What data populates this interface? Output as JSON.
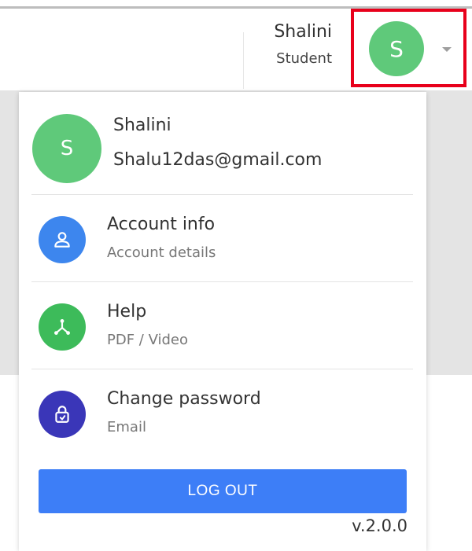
{
  "header": {
    "user_name": "Shalini",
    "user_role": "Student",
    "avatar_initial": "S"
  },
  "dropdown": {
    "avatar_initial": "S",
    "name": "Shalini",
    "email": "Shalu12das@gmail.com",
    "items": [
      {
        "title": "Account info",
        "subtitle": "Account details",
        "icon": "user-icon",
        "color": "#3d86ee"
      },
      {
        "title": "Help",
        "subtitle": "PDF / Video",
        "icon": "share-nodes-icon",
        "color": "#3dbb5a"
      },
      {
        "title": "Change password",
        "subtitle": "Email",
        "icon": "lock-icon",
        "color": "#3a36b8"
      }
    ],
    "logout_label": "LOG OUT",
    "version": "v.2.0.0"
  },
  "colors": {
    "avatar": "#5fc97a",
    "highlight_border": "#e8001b",
    "logout_button": "#3d7ef7"
  }
}
